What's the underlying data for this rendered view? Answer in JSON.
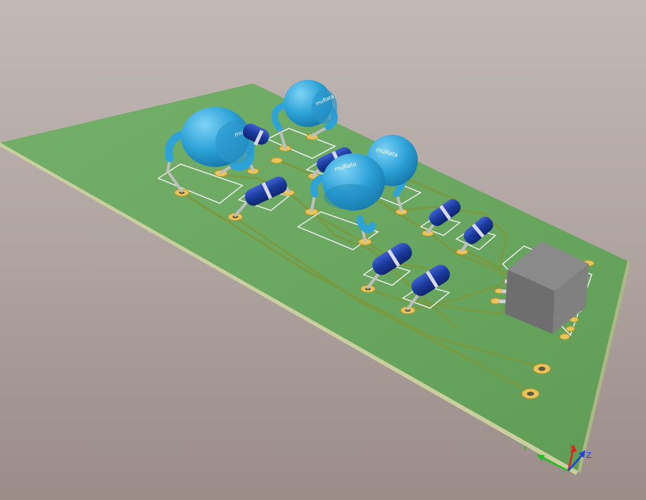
{
  "viewer": {
    "brand_mark": "muRata",
    "axis_labels": {
      "x": "X",
      "y": "Y",
      "z": "Z"
    }
  },
  "colors": {
    "board_top": "#6aa760",
    "board_edge": "#c9cf9e",
    "trace": "#7a9a3e",
    "silkscreen": "#ffffff",
    "pad": "#e8c45a",
    "ceramic_cap": "#2ea3d8",
    "diode_body": "#1a3a9c",
    "ic_body": "#7a7a7a",
    "axis_x": "#e02020",
    "axis_y": "#20c020",
    "axis_z": "#2040e0"
  }
}
